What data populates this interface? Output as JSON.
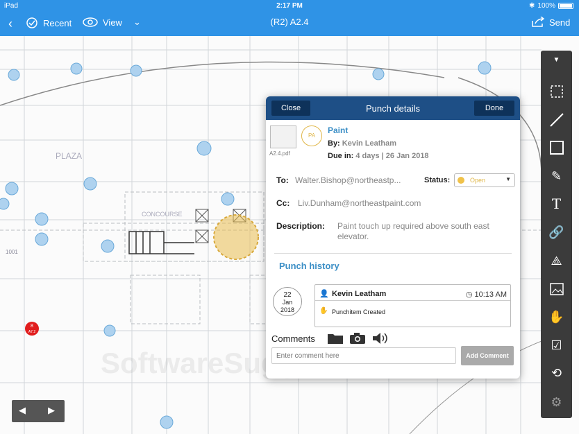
{
  "status_bar": {
    "carrier": "iPad",
    "time": "2:17 PM",
    "battery": "100%"
  },
  "nav": {
    "back_icon": "chevron-left-icon",
    "recent_label": "Recent",
    "view_label": "View",
    "title": "(R2) A2.4",
    "send_label": "Send"
  },
  "blueprint": {
    "plaza_label": "PLAZA",
    "concourse_label": "CONCOURSE",
    "room_label": "1001",
    "marker_label": "8",
    "marker_sub": "A7.2"
  },
  "toolbar": {
    "tools": [
      "collapse-icon",
      "select-icon",
      "line-icon",
      "rectangle-icon",
      "pen-icon",
      "text-icon",
      "link-icon",
      "measure-icon",
      "image-icon",
      "stamp-icon",
      "note-icon",
      "rotate-icon",
      "settings-icon"
    ]
  },
  "punch": {
    "close_label": "Close",
    "title": "Punch details",
    "done_label": "Done",
    "file_name": "A2.4.pdf",
    "avatar_initials": "PA",
    "item_title": "Paint",
    "by_label": "By:",
    "by_value": "Kevin Leatham",
    "due_label": "Due in:",
    "due_value": "4 days | 26 Jan 2018",
    "to_label": "To:",
    "to_value": "Walter.Bishop@northeastp...",
    "status_label": "Status:",
    "status_value": "Open",
    "status_color": "#f0c24a",
    "cc_label": "Cc:",
    "cc_value": "Liv.Dunham@northeastpaint.com",
    "description_label": "Description:",
    "description_value": "Paint touch up required above south east elevator.",
    "history_title": "Punch history",
    "history": {
      "day": "22",
      "month": "Jan",
      "year": "2018",
      "author": "Kevin Leatham",
      "time": "10:13 AM",
      "message": "Punchitem Created"
    },
    "comments_label": "Comments",
    "comment_placeholder": "Enter comment here",
    "add_comment_label": "Add Comment"
  },
  "watermark": "SoftwareSuggest"
}
